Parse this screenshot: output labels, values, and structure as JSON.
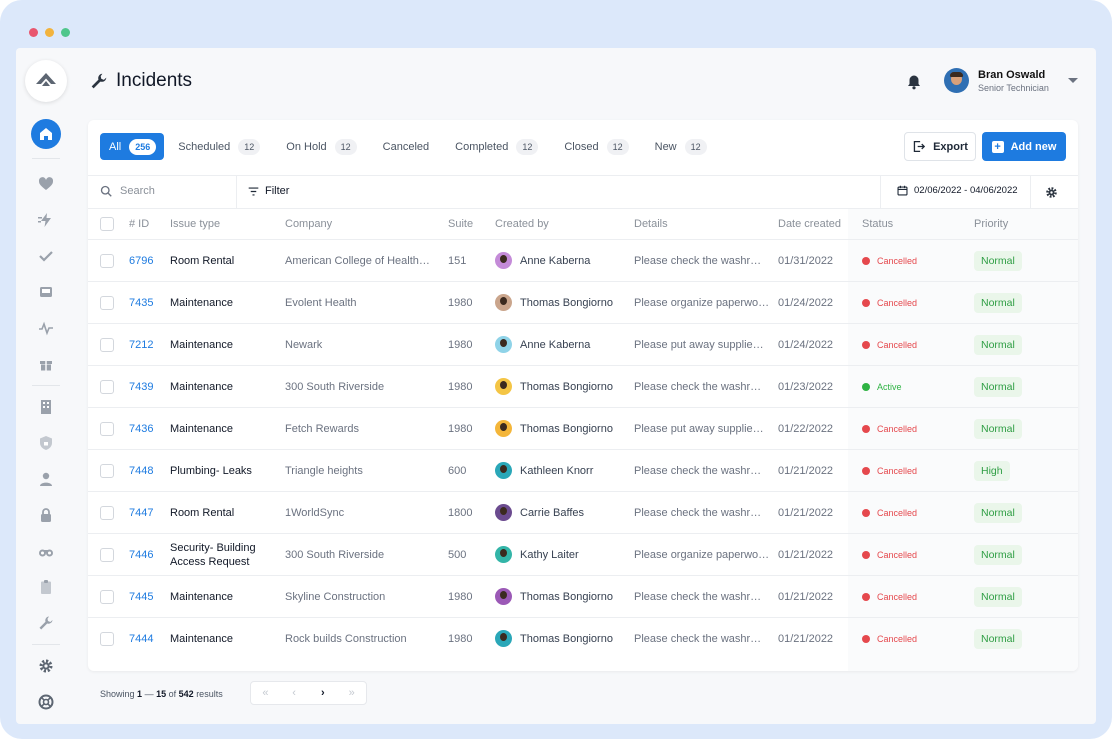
{
  "window_dots": [
    "#e8566e",
    "#f2b33d",
    "#4fc68b"
  ],
  "header": {
    "title": "Incidents",
    "user": {
      "name": "Bran Oswald",
      "role": "Senior Technician"
    }
  },
  "sidebar": {
    "items": [
      {
        "icon": "home-icon",
        "active": true
      },
      {
        "icon": "heart-icon"
      },
      {
        "icon": "lightning-icon"
      },
      {
        "icon": "checkmark-icon"
      },
      {
        "icon": "inbox-icon"
      },
      {
        "icon": "pulse-icon"
      },
      {
        "icon": "gift-icon"
      },
      {
        "icon": "building-icon"
      },
      {
        "icon": "shield-icon"
      },
      {
        "icon": "user-icon"
      },
      {
        "icon": "lock-icon"
      },
      {
        "icon": "binoculars-icon"
      },
      {
        "icon": "clipboard-icon"
      },
      {
        "icon": "wrench-icon"
      },
      {
        "icon": "gear-icon"
      },
      {
        "icon": "lifebuoy-icon"
      }
    ]
  },
  "tabs": [
    {
      "label": "All",
      "count": "256",
      "active": true
    },
    {
      "label": "Scheduled",
      "count": "12"
    },
    {
      "label": "On Hold",
      "count": "12"
    },
    {
      "label": "Canceled",
      "count": ""
    },
    {
      "label": "Completed",
      "count": "12"
    },
    {
      "label": "Closed",
      "count": "12"
    },
    {
      "label": "New",
      "count": "12"
    }
  ],
  "actions": {
    "export_label": "Export",
    "add_label": "Add new"
  },
  "toolbar": {
    "search_placeholder": "Search",
    "filter_label": "Filter",
    "date_range": "02/06/2022 - 04/06/2022"
  },
  "table": {
    "columns": [
      "# ID",
      "Issue type",
      "Company",
      "Suite",
      "Created by",
      "Details",
      "Date created",
      "Status",
      "Priority"
    ],
    "rows": [
      {
        "id": "6796",
        "issue": "Room Rental",
        "company": "American College of Health…",
        "suite": "151",
        "creator": "Anne Kaberna",
        "details": "Please check the washr…",
        "date": "01/31/2022",
        "status": "Cancelled",
        "priority": "Normal",
        "avatar": "#c48bd8"
      },
      {
        "id": "7435",
        "issue": "Maintenance",
        "company": "Evolent Health",
        "suite": "1980",
        "creator": "Thomas Bongiorno",
        "details": "Please organize paperwo…",
        "date": "01/24/2022",
        "status": "Cancelled",
        "priority": "Normal",
        "avatar": "#caa58c"
      },
      {
        "id": "7212",
        "issue": "Maintenance",
        "company": "Newark",
        "suite": "1980",
        "creator": "Anne Kaberna",
        "details": "Please put away supplie…",
        "date": "01/24/2022",
        "status": "Cancelled",
        "priority": "Normal",
        "avatar": "#8fd3e8"
      },
      {
        "id": "7439",
        "issue": "Maintenance",
        "company": "300 South Riverside",
        "suite": "1980",
        "creator": "Thomas Bongiorno",
        "details": "Please check the washr…",
        "date": "01/23/2022",
        "status": "Active",
        "priority": "Normal",
        "avatar": "#f4c545"
      },
      {
        "id": "7436",
        "issue": "Maintenance",
        "company": "Fetch Rewards",
        "suite": "1980",
        "creator": "Thomas Bongiorno",
        "details": "Please put away supplie…",
        "date": "01/22/2022",
        "status": "Cancelled",
        "priority": "Normal",
        "avatar": "#f4b63a"
      },
      {
        "id": "7448",
        "issue": "Plumbing- Leaks",
        "company": "Triangle heights",
        "suite": "600",
        "creator": "Kathleen Knorr",
        "details": "Please check the washr…",
        "date": "01/21/2022",
        "status": "Cancelled",
        "priority": "High",
        "avatar": "#2aa7b8"
      },
      {
        "id": "7447",
        "issue": "Room Rental",
        "company": "1WorldSync",
        "suite": "1800",
        "creator": "Carrie Baffes",
        "details": "Please check the washr…",
        "date": "01/21/2022",
        "status": "Cancelled",
        "priority": "Normal",
        "avatar": "#6b4b8f"
      },
      {
        "id": "7446",
        "issue": "Security- Building Access Request",
        "company": "300 South Riverside",
        "suite": "500",
        "creator": "Kathy Laiter",
        "details": "Please organize paperwo…",
        "date": "01/21/2022",
        "status": "Cancelled",
        "priority": "Normal",
        "avatar": "#33b5a8"
      },
      {
        "id": "7445",
        "issue": "Maintenance",
        "company": "Skyline Construction",
        "suite": "1980",
        "creator": "Thomas Bongiorno",
        "details": "Please check the washr…",
        "date": "01/21/2022",
        "status": "Cancelled",
        "priority": "Normal",
        "avatar": "#9b59b6"
      },
      {
        "id": "7444",
        "issue": "Maintenance",
        "company": "Rock builds Construction",
        "suite": "1980",
        "creator": "Thomas Bongiorno",
        "details": "Please check the washr…",
        "date": "01/21/2022",
        "status": "Cancelled",
        "priority": "Normal",
        "avatar": "#2aa7b8"
      }
    ]
  },
  "status_colors": {
    "Cancelled": "#e5484d",
    "Active": "#2fb344"
  },
  "footer": {
    "from": "1",
    "to": "15",
    "total": "542",
    "results_label": "results",
    "showing_label": "Showing",
    "of_label": "of"
  },
  "accent": "#1e7be0"
}
